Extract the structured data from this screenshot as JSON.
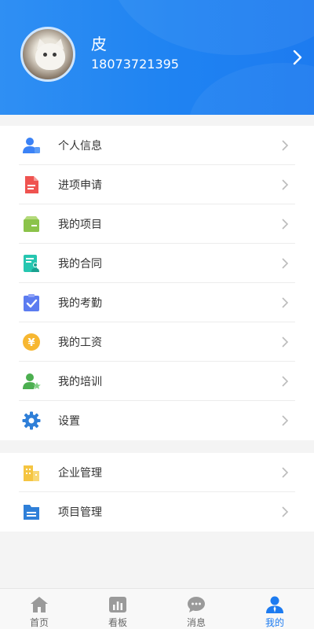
{
  "profile": {
    "name": "皮",
    "phone": "18073721395"
  },
  "menu_primary": [
    {
      "label": "个人信息",
      "icon": "user-info-icon",
      "color": "#3b82f6"
    },
    {
      "label": "进项申请",
      "icon": "document-icon",
      "color": "#ef5350"
    },
    {
      "label": "我的项目",
      "icon": "box-icon",
      "color": "#8bc34a"
    },
    {
      "label": "我的合同",
      "icon": "contract-icon",
      "color": "#26c6b0"
    },
    {
      "label": "我的考勤",
      "icon": "clipboard-check-icon",
      "color": "#5c7cf0"
    },
    {
      "label": "我的工资",
      "icon": "yen-coin-icon",
      "color": "#f7b731"
    },
    {
      "label": "我的培训",
      "icon": "user-star-icon",
      "color": "#4caf50"
    },
    {
      "label": "设置",
      "icon": "gear-icon",
      "color": "#2f7fd8"
    }
  ],
  "menu_secondary": [
    {
      "label": "企业管理",
      "icon": "building-icon",
      "color": "#f5c542"
    },
    {
      "label": "项目管理",
      "icon": "folder-icon",
      "color": "#2f7fd8"
    }
  ],
  "tabs": [
    {
      "label": "首页",
      "icon": "home-icon"
    },
    {
      "label": "看板",
      "icon": "chart-icon"
    },
    {
      "label": "消息",
      "icon": "chat-icon"
    },
    {
      "label": "我的",
      "icon": "person-icon",
      "active": true
    }
  ],
  "colors": {
    "header_blue": "#1d7bf0",
    "tab_active": "#1d7bf0"
  }
}
